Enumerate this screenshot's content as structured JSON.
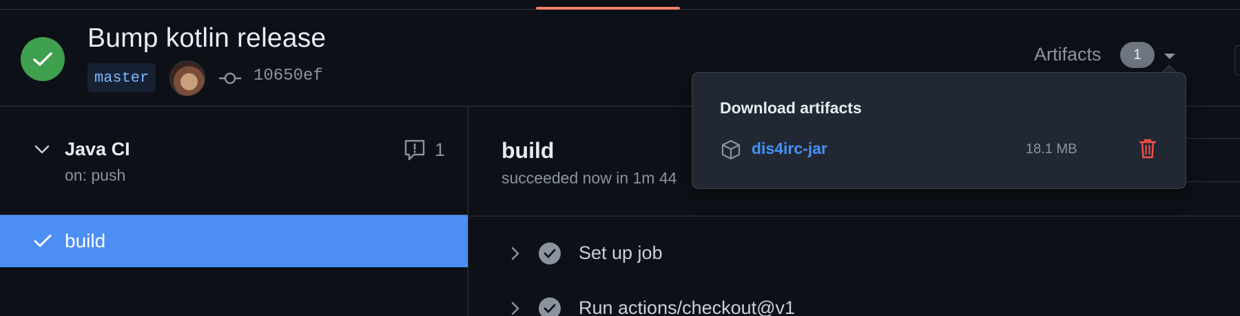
{
  "header": {
    "run_title": "Bump kotlin release",
    "branch": "master",
    "commit_sha": "10650ef",
    "artifacts_label": "Artifacts",
    "artifacts_count": "1",
    "status": "success",
    "status_color": "#3fa04f"
  },
  "sidebar": {
    "workflow_name": "Java CI",
    "workflow_trigger": "on: push",
    "comment_count": "1",
    "jobs": [
      {
        "label": "build",
        "status": "success",
        "selected": true,
        "selected_color": "#4d8ef5"
      }
    ]
  },
  "main": {
    "job_title": "build",
    "job_summary": "succeeded now in 1m 44",
    "steps": [
      {
        "label": "Set up job",
        "status": "success"
      },
      {
        "label": "Run actions/checkout@v1",
        "status": "success"
      }
    ]
  },
  "artifacts_dropdown": {
    "title": "Download artifacts",
    "items": [
      {
        "name": "dis4irc-jar",
        "size": "18.1 MB",
        "link_color": "#4493f8",
        "delete_color": "#f85149"
      }
    ]
  },
  "icons": [
    "check-icon",
    "commit-icon",
    "chevron-down-icon",
    "comment-icon",
    "chevron-right-icon",
    "package-icon",
    "trash-icon",
    "caret-down-icon"
  ]
}
